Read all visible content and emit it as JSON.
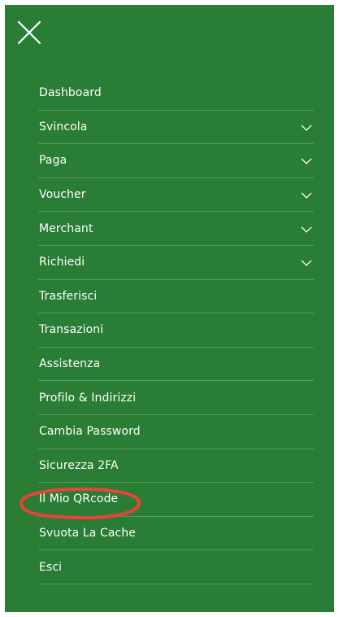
{
  "close_icon": "close-icon",
  "menu": {
    "items": [
      {
        "label": "Dashboard",
        "expandable": false
      },
      {
        "label": "Svincola",
        "expandable": true
      },
      {
        "label": "Paga",
        "expandable": true
      },
      {
        "label": "Voucher",
        "expandable": true
      },
      {
        "label": "Merchant",
        "expandable": true
      },
      {
        "label": "Richiedi",
        "expandable": true
      },
      {
        "label": "Trasferisci",
        "expandable": false
      },
      {
        "label": "Transazioni",
        "expandable": false
      },
      {
        "label": "Assistenza",
        "expandable": false
      },
      {
        "label": "Profilo & Indirizzi",
        "expandable": false
      },
      {
        "label": "Cambia Password",
        "expandable": false
      },
      {
        "label": "Sicurezza 2FA",
        "expandable": false
      },
      {
        "label": "Il Mio QRcode",
        "expandable": false,
        "highlighted": true
      },
      {
        "label": "Svuota La Cache",
        "expandable": false
      },
      {
        "label": "Esci",
        "expandable": false
      }
    ]
  },
  "colors": {
    "panel_background": "#2a7d34",
    "text": "#ffffff",
    "highlight_annotation": "#e8443a"
  }
}
